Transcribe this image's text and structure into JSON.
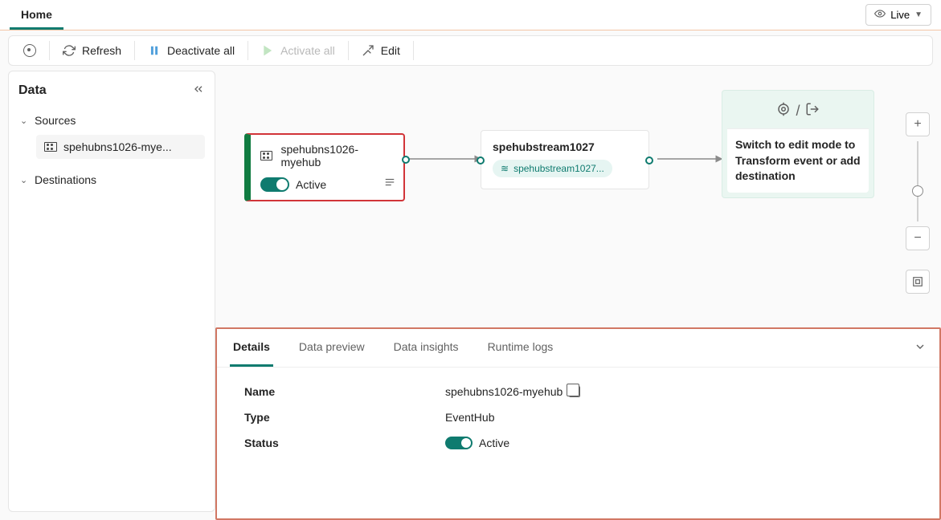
{
  "tabs": {
    "home": "Home"
  },
  "live": "Live",
  "toolbar": {
    "refresh": "Refresh",
    "deactivate": "Deactivate all",
    "activate": "Activate all",
    "edit": "Edit"
  },
  "sidebar": {
    "title": "Data",
    "sources": "Sources",
    "source_item": "spehubns1026-mye...",
    "destinations": "Destinations"
  },
  "nodes": {
    "source": {
      "name": "spehubns1026-myehub",
      "status": "Active"
    },
    "stream": {
      "name": "spehubstream1027",
      "pill": "spehubstream1027..."
    },
    "dest": {
      "text": "Switch to edit mode to Transform event or add destination"
    }
  },
  "panel": {
    "tabs": {
      "details": "Details",
      "preview": "Data preview",
      "insights": "Data insights",
      "logs": "Runtime logs"
    },
    "rows": {
      "name": {
        "label": "Name",
        "value": "spehubns1026-myehub"
      },
      "type": {
        "label": "Type",
        "value": "EventHub"
      },
      "status": {
        "label": "Status",
        "value": "Active"
      }
    }
  }
}
